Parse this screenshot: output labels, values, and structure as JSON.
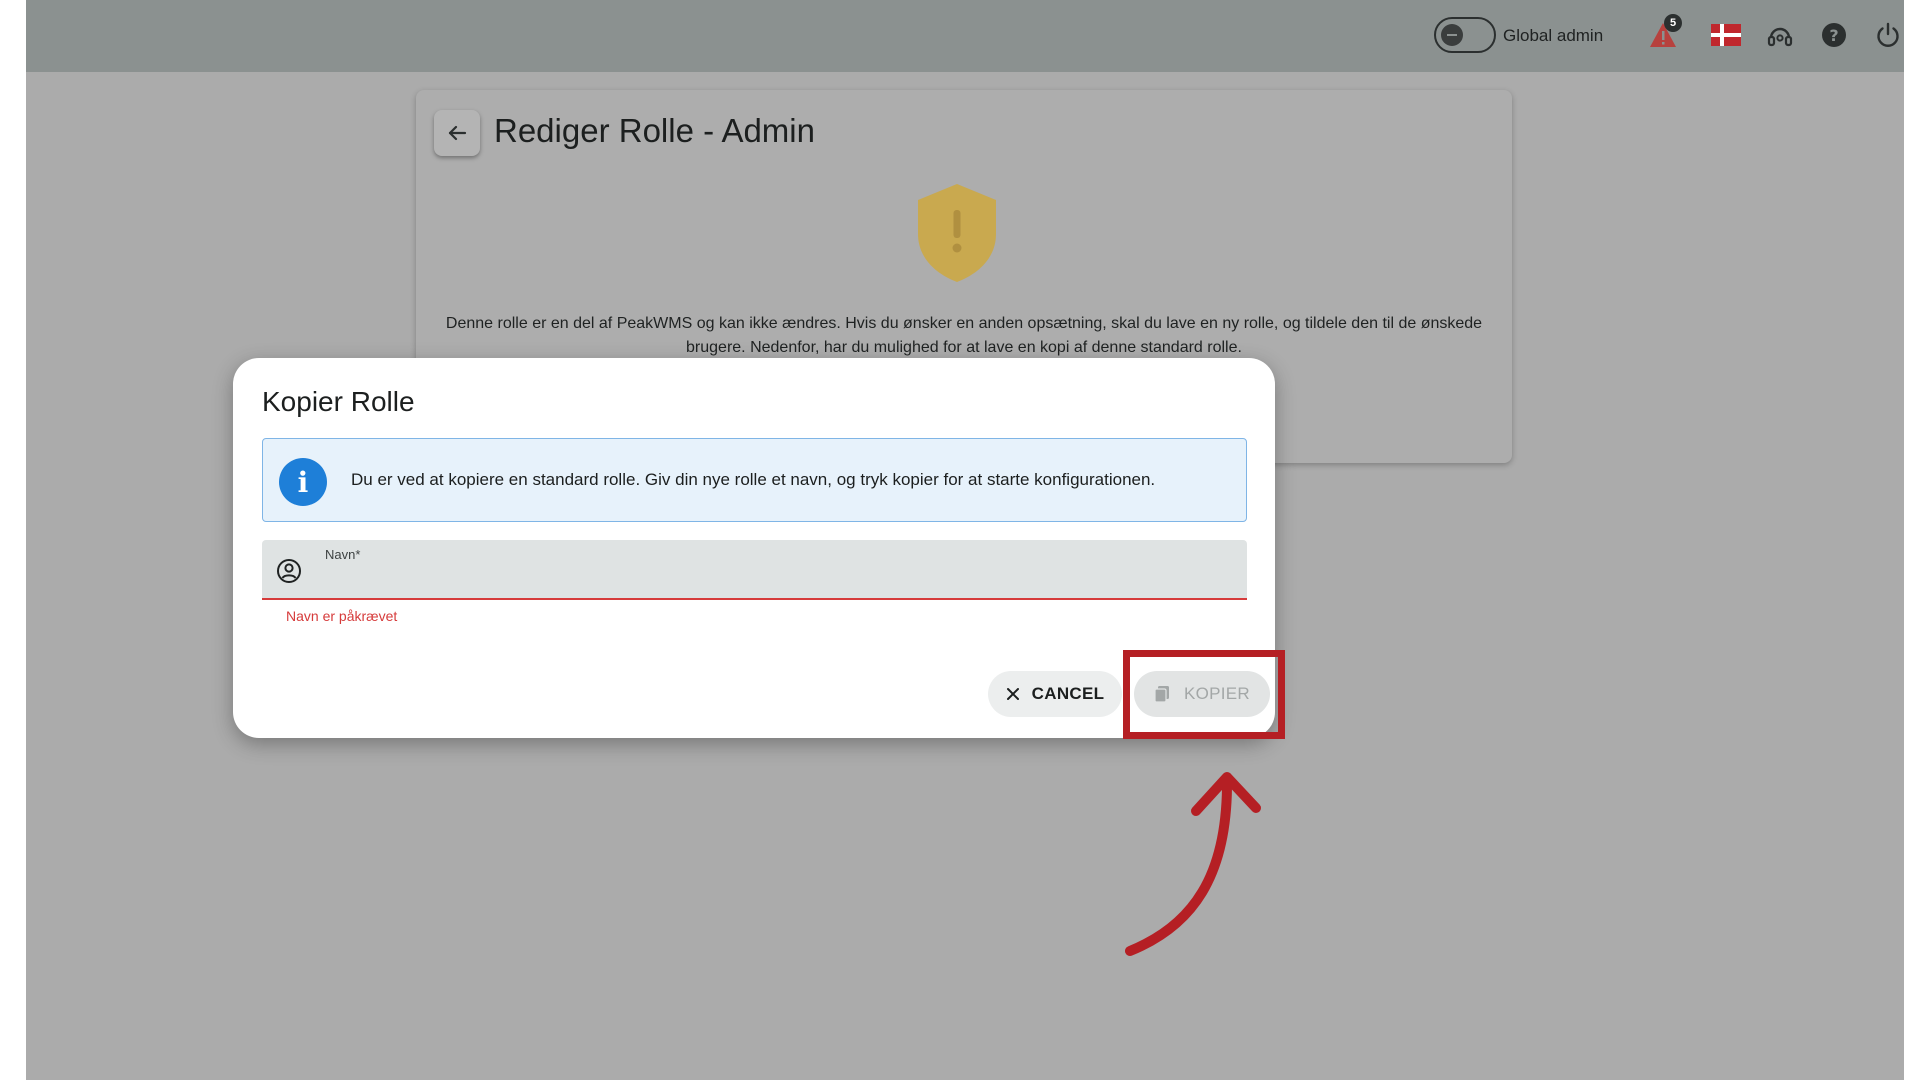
{
  "topbar": {
    "toggle_state": "off",
    "global_label": "Global admin",
    "alert_count": "5",
    "icons": [
      "alert-icon",
      "danish-flag-icon",
      "support-headset-icon",
      "help-icon",
      "power-icon"
    ]
  },
  "card": {
    "title": "Rediger Rolle - Admin",
    "description": "Denne rolle er en del af PeakWMS og kan ikke ændres. Hvis du ønsker en anden opsætning, skal du lave en ny rolle, og tildele den til de ønskede brugere. Nedenfor, har du mulighed for at lave en kopi af denne standard rolle.",
    "icons": [
      "back-arrow-icon",
      "shield-warning-icon"
    ]
  },
  "dialog": {
    "title": "Kopier Rolle",
    "info_icon": "i",
    "info_text": "Du er ved at kopiere en standard rolle. Giv din nye rolle et navn, og tryk kopier for at starte konfigurationen.",
    "name_label": "Navn*",
    "name_value": "",
    "name_error": "Navn er påkrævet",
    "cancel_label": "CANCEL",
    "kopier_label": "KOPIER",
    "kopier_disabled": true
  },
  "colors": {
    "topbar": "#8b9190",
    "backdrop": "#ababab",
    "info_blue": "#1e7fd8",
    "error_red": "#d63b3b",
    "annotation_red": "#b51f24",
    "shield_gold": "#c9a94f"
  }
}
